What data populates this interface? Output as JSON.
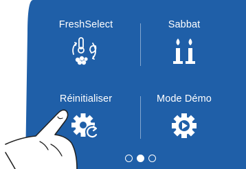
{
  "colors": {
    "panel": "#1f5fa8",
    "text": "#ffffff"
  },
  "tiles": [
    {
      "label": "FreshSelect",
      "icon": "fresh-select-icon"
    },
    {
      "label": "Sabbat",
      "icon": "candles-icon"
    },
    {
      "label": "Réinitialiser",
      "icon": "gear-reset-icon"
    },
    {
      "label": "Mode Démo",
      "icon": "gear-play-icon"
    }
  ],
  "pagination": {
    "total": 3,
    "active_index": 1
  }
}
